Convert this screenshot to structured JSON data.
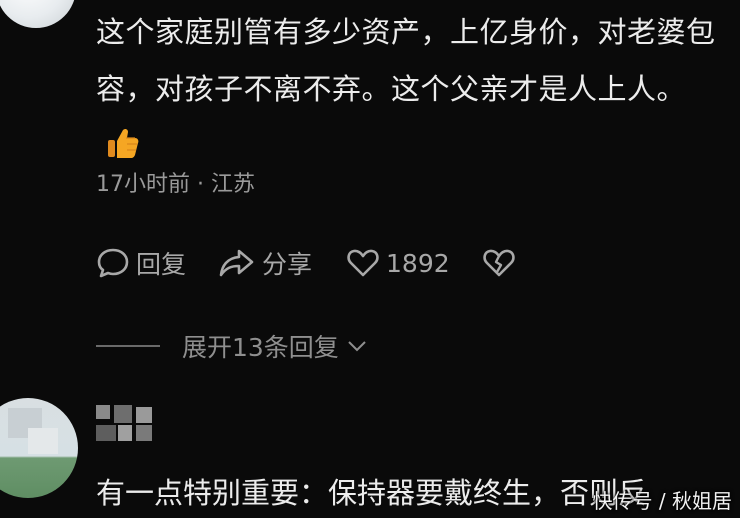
{
  "comment": {
    "text": "这个家庭别管有多少资产，上亿身价，对老婆包容，对孩子不离不弃。这个父亲才是人上人。",
    "emoji": "thumbs-up",
    "time": "17小时前",
    "separator": "·",
    "location": "江苏"
  },
  "actions": {
    "reply_label": "回复",
    "share_label": "分享",
    "like_count": "1892"
  },
  "replies": {
    "expand_label": "展开13条回复"
  },
  "next_comment": {
    "text": "有一点特别重要：保持器要戴终生，否则反"
  },
  "watermark": {
    "text": "快传号 / 秋姐居"
  },
  "colors": {
    "background": "#0a0a0a",
    "text": "#ececec",
    "muted": "#9a9a9a",
    "thumb": "#f5a623"
  }
}
